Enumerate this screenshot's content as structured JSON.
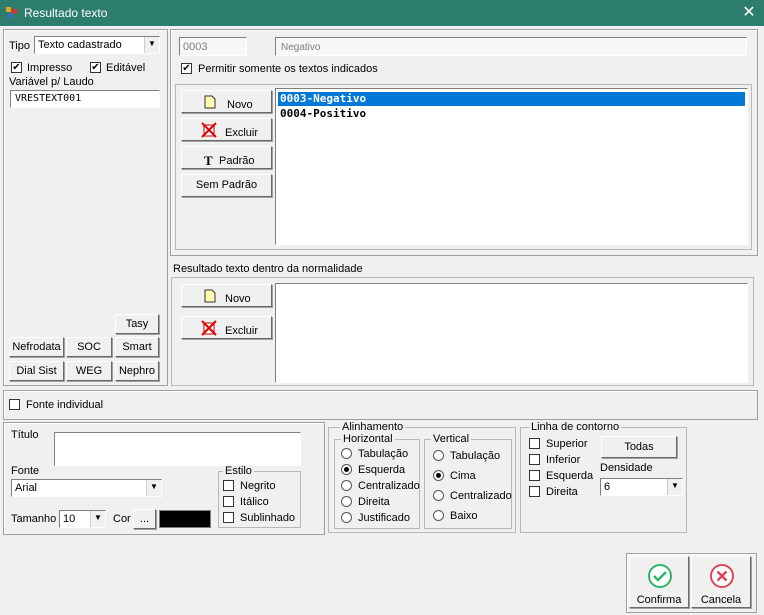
{
  "window": {
    "title": "Resultado texto"
  },
  "left": {
    "tipo_label": "Tipo",
    "tipo_value": "Texto cadastrado",
    "impresso_label": "Impresso",
    "editavel_label": "Editável",
    "variavel_label": "Variável p/ Laudo",
    "variavel_value": "VRESTEXT001",
    "buttons": {
      "tasy": "Tasy",
      "nefrodata": "Nefrodata",
      "soc": "SOC",
      "smart": "Smart",
      "dialsist": "Dial Sist",
      "weg": "WEG",
      "nephro": "Nephro"
    }
  },
  "top": {
    "code_value": "0003",
    "desc_value": "Negativo",
    "permitir_label": "Permitir somente os textos indicados",
    "novo": "Novo",
    "excluir": "Excluir",
    "padrao": "Padrão",
    "sem_padrao": "Sem Padrão",
    "list": [
      "0003-Negativo",
      "0004-Positivo"
    ]
  },
  "normal": {
    "label": "Resultado texto dentro da normalidade",
    "novo": "Novo",
    "excluir": "Excluir"
  },
  "fonte_individual": "Fonte individual",
  "font": {
    "titulo_label": "Título",
    "fonte_label": "Fonte",
    "fonte_value": "Arial",
    "tamanho_label": "Tamanho",
    "tamanho_value": "10",
    "cor_label": "Cor",
    "cor_btn": "...",
    "color": "#000000",
    "estilo_label": "Estilo",
    "negrito": "Negrito",
    "italico": "Itálico",
    "sublinhado": "Sublinhado"
  },
  "align": {
    "label": "Alinhamento",
    "horizontal_label": "Horizontal",
    "h": [
      "Tabulação",
      "Esquerda",
      "Centralizado",
      "Direita",
      "Justificado"
    ],
    "vertical_label": "Vertical",
    "v": [
      "Tabulação",
      "Cima",
      "Centralizado",
      "Baixo"
    ]
  },
  "contorno": {
    "label": "Linha de contorno",
    "superior": "Superior",
    "inferior": "Inferior",
    "esquerda": "Esquerda",
    "direita": "Direita",
    "todas": "Todas",
    "densidade_label": "Densidade",
    "densidade_value": "6"
  },
  "footer": {
    "confirma": "Confirma",
    "cancela": "Cancela"
  }
}
